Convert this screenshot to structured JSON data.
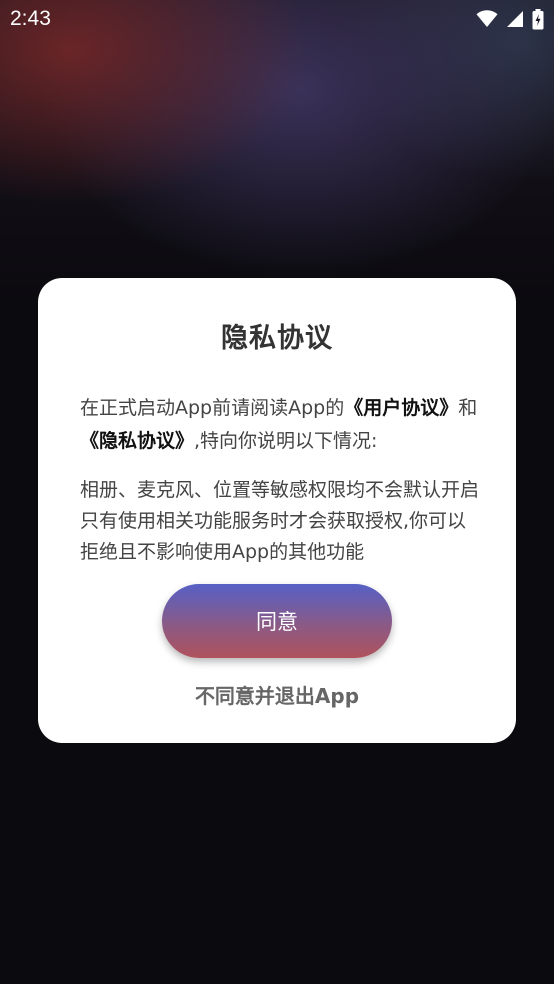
{
  "status_bar": {
    "time": "2:43",
    "icons": [
      "wifi-icon",
      "cell-signal-icon",
      "battery-icon"
    ]
  },
  "dialog": {
    "title": "隐私协议",
    "intro": {
      "before": "在正式启动App前请阅读App的",
      "user_agreement": "《用户协议》",
      "and": "和",
      "privacy_policy": "《隐私协议》",
      "after": ",特向你说明以下情况:"
    },
    "permissions_text": "相册、麦克风、位置等敏感权限均不会默认开启只有使用相关功能服务时才会获取授权,你可以拒绝且不影响使用App的其他功能",
    "agree_label": "同意",
    "disagree_label": "不同意并退出App"
  },
  "colors": {
    "button_top": "#5660c6",
    "button_bottom": "#b0525c",
    "dialog_bg": "#ffffff"
  }
}
